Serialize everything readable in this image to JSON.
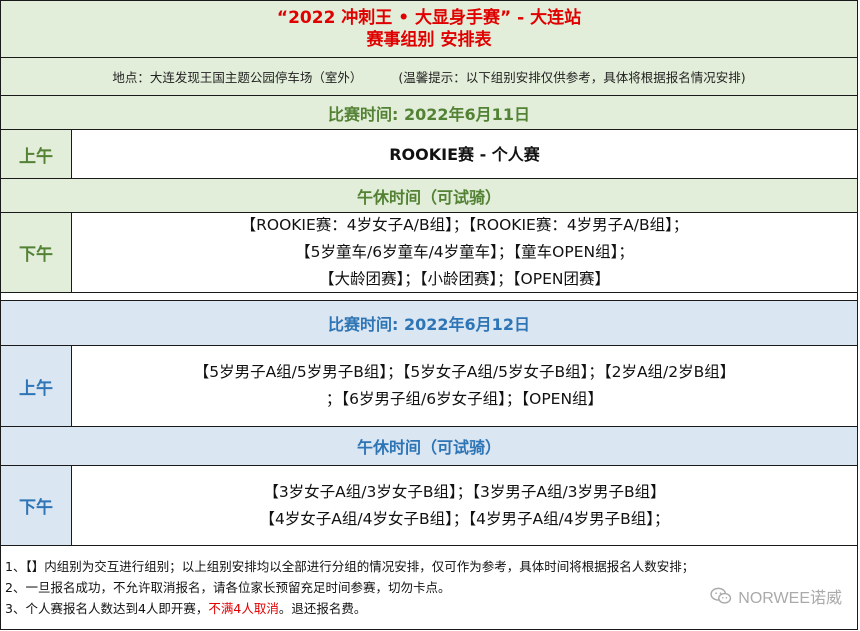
{
  "header": {
    "title_line1": "“2022 冲刺王 • 大显身手赛” - 大连站",
    "title_line2": "赛事组别  安排表",
    "location": "地点：大连发现王国主题公园停车场（室外）",
    "tip": "(温馨提示：以下组别安排仅供参考，具体将根据报名情况安排)"
  },
  "day1": {
    "date_label": "比赛时间: 2022年6月11日",
    "morning_label": "上午",
    "morning_content": "ROOKIE赛 - 个人赛",
    "break_label": "午休时间（可试骑）",
    "afternoon_label": "下午",
    "afternoon_lines": [
      "【ROOKIE赛：4岁女子A/B组】；【ROOKIE赛：4岁男子A/B组】；",
      "【5岁童车/6岁童车/4岁童车】；【童车OPEN组】；",
      "【大龄团赛】；【小龄团赛】；【OPEN团赛】"
    ]
  },
  "day2": {
    "date_label": "比赛时间: 2022年6月12日",
    "morning_label": "上午",
    "morning_lines": [
      "【5岁男子A组/5岁男子B组】；【5岁女子A组/5岁女子B组】；【2岁A组/2岁B组】",
      "；【6岁男子组/6岁女子组】；【OPEN组】"
    ],
    "break_label": "午休时间（可试骑）",
    "afternoon_label": "下午",
    "afternoon_lines": [
      "【3岁女子A组/3岁女子B组】；【3岁男子A组/3岁男子B组】",
      "【4岁女子A组/4岁女子B组】；【4岁男子A组/4岁男子B组】；"
    ]
  },
  "notes": {
    "note1": "1、【】内组别为交互进行组别；以上组别安排均以全部进行分组的情况安排，仅可作为参考，具体时间将根据报名人数安排；",
    "note2": "2、一旦报名成功，不允许取消报名，请各位家长预留充足时间参赛，切勿卡点。",
    "note3_prefix": "3、个人赛报名人数达到4人即开赛，",
    "note3_red": "不满4人取消",
    "note3_suffix": "。退还报名费。"
  },
  "watermark": {
    "text": "NORWEE诺威",
    "icon": "wechat-icon"
  },
  "colors": {
    "title_red": "#e00000",
    "green_text": "#548235",
    "green_bg": "#e2eed9",
    "blue_text": "#2e75b6",
    "blue_bg": "#dbe6f3"
  }
}
